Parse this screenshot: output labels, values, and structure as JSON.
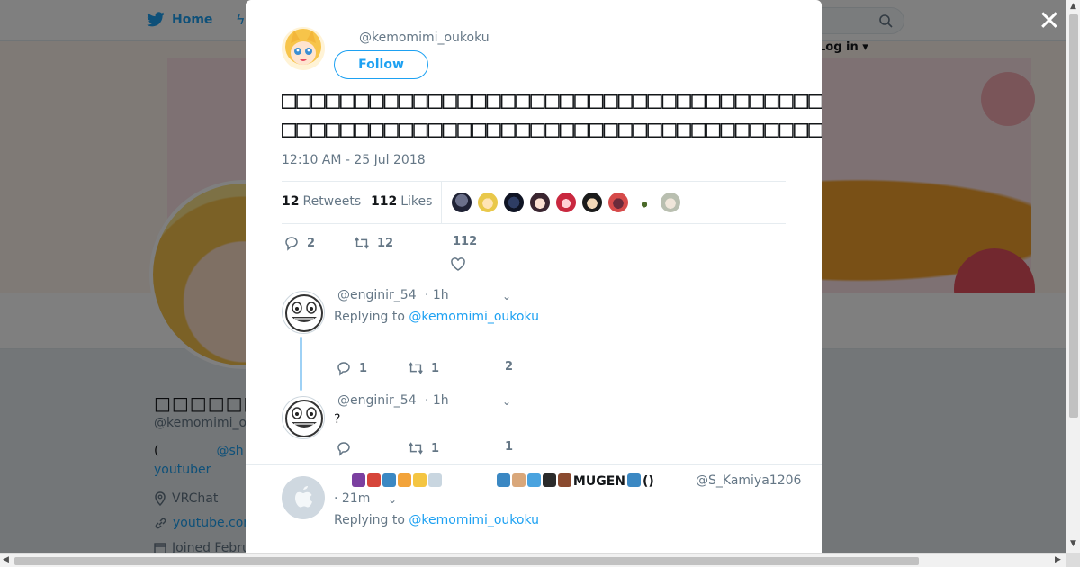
{
  "nav": {
    "home_label": "Home",
    "login_label": "Log in"
  },
  "profile_bg": {
    "name": "□□□□□□□□□",
    "handle": "@kemomimi_o",
    "bio_prefix": "(",
    "bio_link": "@sh",
    "bio_line2": "youtuber",
    "location": "VRChat",
    "url": "youtube.com",
    "joined": "Joined Febru"
  },
  "modal": {
    "close_label": "✕",
    "author_handle": "@kemomimi_oukoku",
    "follow_label": "Follow",
    "tweet_line1": "□□□□□□□□□□□□□□□□□□□□□□□□□□□□□□□□□□□□□□□□□□□□□□□□",
    "tweet_line2": "□□□□□□□□□□□□□□□□□□□□□□□□□□□□□□□□□□□□□□□□□□",
    "timestamp": "12:10 AM - 25 Jul 2018",
    "retweets_count": "12",
    "retweets_label": "Retweets",
    "likes_count": "112",
    "likes_label": "Likes",
    "actions": {
      "replies": "2",
      "retweets": "12",
      "likes": "112"
    }
  },
  "replies": [
    {
      "handle": "@enginir_54",
      "time": "· 1h",
      "replying_prefix": "Replying to",
      "replying_to": "@kemomimi_oukoku",
      "text": "",
      "actions": {
        "replies": "1",
        "retweets": "1",
        "likes": "2"
      }
    },
    {
      "handle": "@enginir_54",
      "time": "· 1h",
      "text": "?",
      "actions": {
        "replies": "",
        "retweets": "1",
        "likes": "1"
      }
    },
    {
      "display_name": "MUGEN",
      "name_suffix": "()",
      "handle": "@S_Kamiya1206",
      "time": "· 21m",
      "replying_prefix": "Replying to",
      "replying_to": "@kemomimi_oukoku"
    }
  ],
  "colors": {
    "accent": "#1da1f2",
    "thread_line": "#9ed1f5",
    "muted_text": "#657786"
  }
}
